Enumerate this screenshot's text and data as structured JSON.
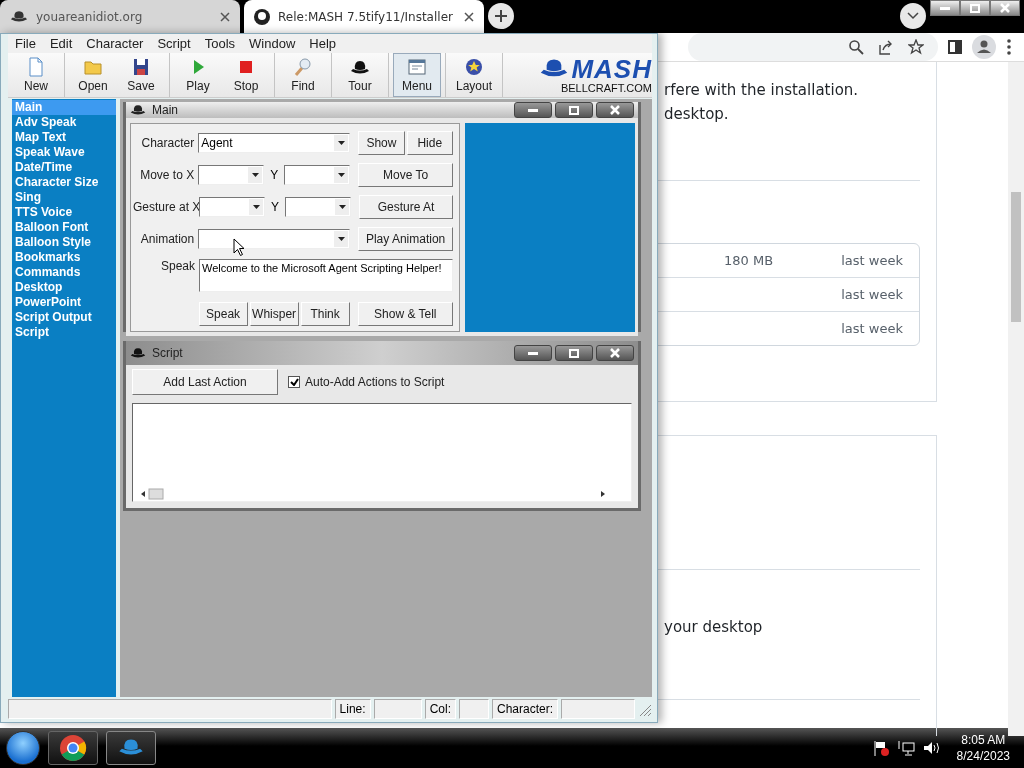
{
  "browser": {
    "tabs": [
      {
        "title": "youareanidiot.org",
        "selected": false
      },
      {
        "title": "Rele:MASH 7.5tify11/Installer",
        "selected": true
      }
    ],
    "content": {
      "lines": [
        "rfere with the installation.",
        "desktop."
      ],
      "rows": [
        {
          "size": "180 MB",
          "time": "last week"
        },
        {
          "time": "last week"
        },
        {
          "time": "last week"
        }
      ],
      "footer_text": "your desktop"
    }
  },
  "mash": {
    "menu": [
      "File",
      "Edit",
      "Character",
      "Script",
      "Tools",
      "Window",
      "Help"
    ],
    "toolbar": [
      {
        "buttons": [
          {
            "label": "New",
            "selected": false
          }
        ]
      },
      {
        "buttons": [
          {
            "label": "Open",
            "selected": false
          },
          {
            "label": "Save",
            "selected": false
          }
        ]
      },
      {
        "buttons": [
          {
            "label": "Play",
            "selected": false
          },
          {
            "label": "Stop",
            "selected": false
          }
        ]
      },
      {
        "buttons": [
          {
            "label": "Find",
            "selected": false
          }
        ]
      },
      {
        "buttons": [
          {
            "label": "Tour",
            "selected": false
          }
        ]
      },
      {
        "buttons": [
          {
            "label": "Menu",
            "selected": true
          }
        ]
      },
      {
        "buttons": [
          {
            "label": "Layout",
            "selected": false
          }
        ]
      }
    ],
    "logo": {
      "title": "MASH",
      "subtitle": "BELLCRAFT.COM"
    },
    "sidebar": [
      {
        "label": "Main",
        "selected": true
      },
      {
        "label": "Adv Speak",
        "selected": false
      },
      {
        "label": "Map Text",
        "selected": false
      },
      {
        "label": "Speak Wave",
        "selected": false
      },
      {
        "label": "Date/Time",
        "selected": false
      },
      {
        "label": "Character Size",
        "selected": false
      },
      {
        "label": "Sing",
        "selected": false
      },
      {
        "label": "TTS Voice",
        "selected": false
      },
      {
        "label": "Balloon Font",
        "selected": false
      },
      {
        "label": "Balloon Style",
        "selected": false
      },
      {
        "label": "Bookmarks",
        "selected": false
      },
      {
        "label": "Commands",
        "selected": false
      },
      {
        "label": "Desktop",
        "selected": false
      },
      {
        "label": "PowerPoint",
        "selected": false
      },
      {
        "label": "Script Output",
        "selected": false
      },
      {
        "label": "Script",
        "selected": false
      }
    ],
    "main_window": {
      "title": "Main",
      "rows": [
        {
          "kind": "combo",
          "label": "Character",
          "value": "Agent",
          "buttons": [
            "Show",
            "Hide"
          ]
        },
        {
          "kind": "xy",
          "label": "Move to X",
          "y_label": "Y",
          "buttons": [
            "Move To"
          ]
        },
        {
          "kind": "xy",
          "label": "Gesture at X",
          "y_label": "Y",
          "buttons": [
            "Gesture At"
          ]
        },
        {
          "kind": "combo",
          "label": "Animation",
          "buttons": [
            "Play Animation"
          ]
        },
        {
          "kind": "text",
          "label": "Speak",
          "value": "Welcome to the Microsoft Agent Scripting Helper!"
        }
      ],
      "actions": [
        "Speak",
        "Whisper",
        "Think",
        "Show & Tell"
      ]
    },
    "script_window": {
      "title": "Script",
      "button": "Add Last Action",
      "checkbox": {
        "label": "Auto-Add Actions to Script",
        "checked": true
      }
    },
    "status_bar": [
      {
        "label": "Line:"
      },
      {
        "label": "Col:"
      },
      {
        "label": "Character:"
      }
    ]
  },
  "taskbar": {
    "time": "8:05 AM",
    "date": "8/24/2023"
  }
}
